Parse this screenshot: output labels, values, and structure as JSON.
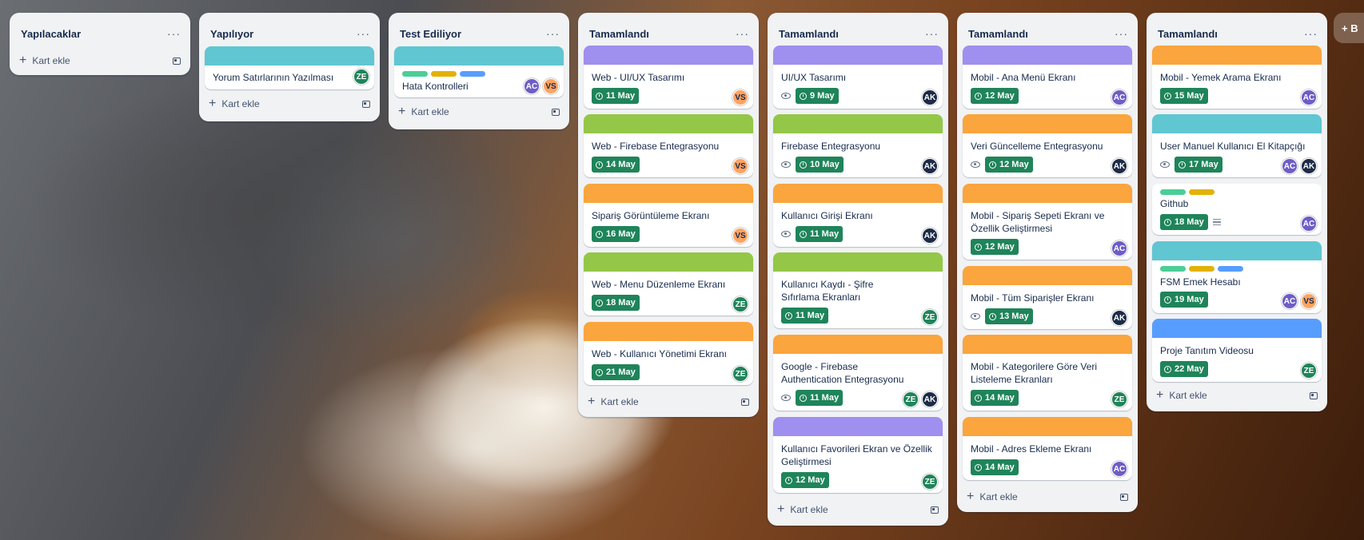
{
  "colors": {
    "purple": "#9f8fef",
    "green": "#94c748",
    "orange": "#faa53d",
    "teal": "#60c6d2",
    "blue": "#579dff",
    "due": "#1f845a",
    "label_green": "#4bce97",
    "label_yellow": "#e2b203",
    "label_blue": "#579dff"
  },
  "members": {
    "ZE": "#1f845a",
    "VS": "#fea362",
    "AC": "#6e5dc6",
    "AK": "#1d2b47"
  },
  "common": {
    "add_card": "Kart ekle",
    "menu": "···"
  },
  "add_list": {
    "label": "+ B"
  },
  "lists": [
    {
      "title": "Yapılacaklar",
      "cards": []
    },
    {
      "title": "Yapılıyor",
      "cards": [
        {
          "title": "Yorum Satırlarının Yazılması",
          "cover": "teal",
          "members": [
            "ZE"
          ]
        }
      ]
    },
    {
      "title": "Test Ediliyor",
      "cards": [
        {
          "title": "Hata Kontrolleri",
          "cover": "teal",
          "labels": [
            "label_green",
            "label_yellow",
            "label_blue"
          ],
          "members": [
            "AC",
            "VS"
          ]
        }
      ]
    },
    {
      "title": "Tamamlandı",
      "cards": [
        {
          "title": "Web - UI/UX Tasarımı",
          "cover": "purple",
          "due": "11 May",
          "members": [
            "VS"
          ]
        },
        {
          "title": "Web - Firebase Entegrasyonu",
          "cover": "green",
          "due": "14 May",
          "members": [
            "VS"
          ]
        },
        {
          "title": "Sipariş Görüntüleme Ekranı",
          "cover": "orange",
          "due": "16 May",
          "members": [
            "VS"
          ]
        },
        {
          "title": "Web - Menu Düzenleme Ekranı",
          "cover": "green",
          "due": "18 May",
          "members": [
            "ZE"
          ]
        },
        {
          "title": "Web - Kullanıcı Yönetimi Ekranı",
          "cover": "orange",
          "due": "21 May",
          "members": [
            "ZE"
          ]
        }
      ]
    },
    {
      "title": "Tamamlandı",
      "cards": [
        {
          "title": "UI/UX Tasarımı",
          "cover": "purple",
          "due": "9 May",
          "watch": true,
          "members": [
            "AK"
          ]
        },
        {
          "title": "Firebase Entegrasyonu",
          "cover": "green",
          "due": "10 May",
          "watch": true,
          "members": [
            "AK"
          ]
        },
        {
          "title": "Kullanıcı Girişi Ekranı",
          "cover": "orange",
          "due": "11 May",
          "watch": true,
          "members": [
            "AK"
          ]
        },
        {
          "title": "Kullanıcı Kaydı - Şifre Sıfırlama Ekranları",
          "cover": "green",
          "due": "11 May",
          "members": [
            "ZE"
          ]
        },
        {
          "title": "Google - Firebase Authentication Entegrasyonu",
          "cover": "orange",
          "due": "11 May",
          "watch": true,
          "members": [
            "ZE",
            "AK"
          ]
        },
        {
          "title": "Kullanıcı Favorileri Ekran ve Özellik Geliştirmesi",
          "cover": "purple",
          "due": "12 May",
          "members": [
            "ZE"
          ]
        }
      ]
    },
    {
      "title": "Tamamlandı",
      "cards": [
        {
          "title": "Mobil - Ana Menü Ekranı",
          "cover": "purple",
          "due": "12 May",
          "members": [
            "AC"
          ]
        },
        {
          "title": "Veri Güncelleme Entegrasyonu",
          "cover": "orange",
          "due": "12 May",
          "watch": true,
          "members": [
            "AK"
          ]
        },
        {
          "title": "Mobil - Sipariş Sepeti Ekranı ve Özellik Geliştirmesi",
          "cover": "orange",
          "due": "12 May",
          "members": [
            "AC"
          ]
        },
        {
          "title": "Mobil - Tüm Siparişler Ekranı",
          "cover": "orange",
          "due": "13 May",
          "watch": true,
          "members": [
            "AK"
          ]
        },
        {
          "title": "Mobil - Kategorilere Göre Veri Listeleme Ekranları",
          "cover": "orange",
          "due": "14 May",
          "members": [
            "ZE"
          ]
        },
        {
          "title": "Mobil - Adres Ekleme Ekranı",
          "cover": "orange",
          "due": "14 May",
          "members": [
            "AC"
          ]
        }
      ]
    },
    {
      "title": "Tamamlandı",
      "cards": [
        {
          "title": "Mobil - Yemek Arama Ekranı",
          "cover": "orange",
          "due": "15 May",
          "members": [
            "AC"
          ]
        },
        {
          "title": "User Manuel Kullanıcı El Kitapçığı",
          "cover": "teal",
          "due": "17 May",
          "watch": true,
          "members": [
            "AC",
            "AK"
          ]
        },
        {
          "title": "Github",
          "labels": [
            "label_green",
            "label_yellow"
          ],
          "due": "18 May",
          "description": true,
          "members": [
            "AC"
          ]
        },
        {
          "title": "FSM Emek Hesabı",
          "cover": "teal",
          "labels": [
            "label_green",
            "label_yellow",
            "label_blue"
          ],
          "due": "19 May",
          "members": [
            "AC",
            "VS"
          ]
        },
        {
          "title": "Proje Tanıtım Videosu",
          "cover": "blue",
          "due": "22 May",
          "members": [
            "ZE"
          ]
        }
      ]
    }
  ]
}
